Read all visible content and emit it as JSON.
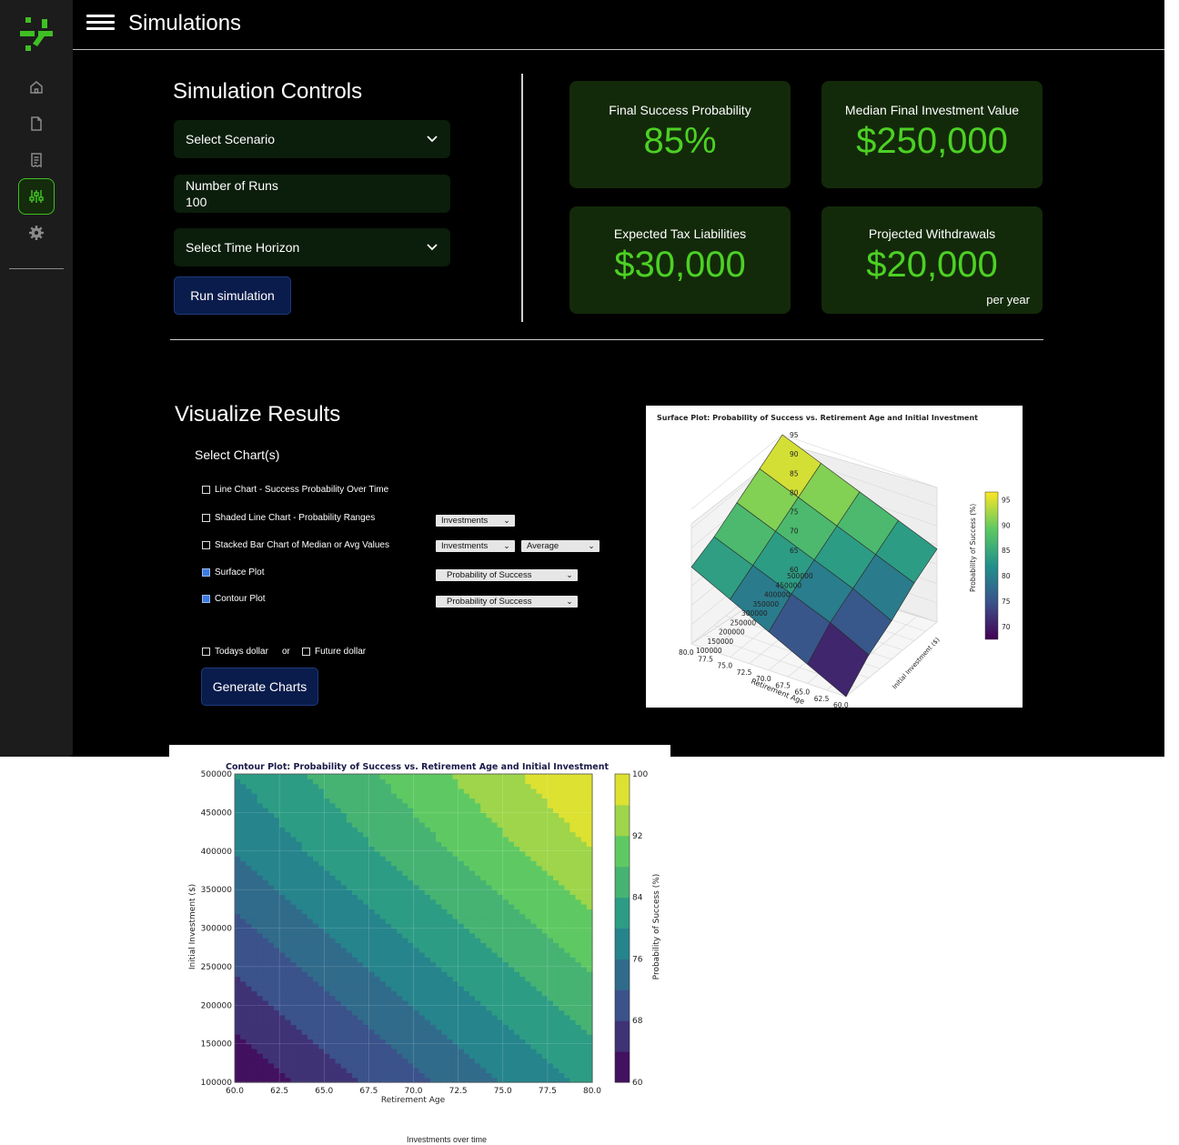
{
  "header": {
    "title": "Simulations"
  },
  "sidebar": {
    "items": [
      {
        "name": "home",
        "icon": "home-icon"
      },
      {
        "name": "documents",
        "icon": "document-icon"
      },
      {
        "name": "reports",
        "icon": "receipt-icon"
      },
      {
        "name": "simulations",
        "icon": "sliders-icon",
        "active": true
      },
      {
        "name": "settings",
        "icon": "gear-icon"
      }
    ],
    "accent": "#3fbf23"
  },
  "controls": {
    "title": "Simulation Controls",
    "scenario_label": "Select Scenario",
    "runs_label": "Number of Runs",
    "runs_value": "100",
    "horizon_label": "Select Time Horizon",
    "run_button": "Run simulation"
  },
  "cards": [
    {
      "label": "Final Success Probability",
      "value": "85%"
    },
    {
      "label": "Median Final Investment Value",
      "value": "$250,000"
    },
    {
      "label": "Expected Tax Liabilities",
      "value": "$30,000"
    },
    {
      "label": "Projected Withdrawals",
      "value": "$20,000",
      "sub": "per year"
    }
  ],
  "visualize": {
    "title": "Visualize Results",
    "select_label": "Select Chart(s)",
    "charts": [
      {
        "label": "Line Chart - Success Probability Over Time",
        "checked": false
      },
      {
        "label": "Shaded Line Chart - Probability Ranges",
        "checked": false,
        "dropdowns": [
          "Investments"
        ]
      },
      {
        "label": "Stacked Bar Chart of Median or Avg Values",
        "checked": false,
        "dropdowns": [
          "Investments",
          "Average"
        ]
      },
      {
        "label": "Surface Plot",
        "checked": true,
        "dropdowns": [
          "Probability of Success"
        ]
      },
      {
        "label": "Contour Plot",
        "checked": true,
        "dropdowns": [
          "Probability of Success"
        ]
      }
    ],
    "todays_dollar": "Todays dollar",
    "or": "or",
    "future_dollar": "Future dollar",
    "generate_button": "Generate Charts"
  },
  "chart_data": [
    {
      "type": "surface",
      "title": "Surface Plot: Probability of Success vs. Retirement Age and Initial Investment",
      "xlabel": "Retirement Age",
      "ylabel": "Initial Investment ($)",
      "zlabel": "Probability of Success (%)",
      "x_ticks": [
        "60.0",
        "62.5",
        "65.0",
        "67.5",
        "70.0",
        "72.5",
        "75.0",
        "77.5",
        "80.0"
      ],
      "y_ticks": [
        "100000",
        "150000",
        "200000",
        "250000",
        "300000",
        "350000",
        "400000",
        "450000",
        "500000"
      ],
      "z_ticks": [
        "60",
        "65",
        "70",
        "75",
        "80",
        "85",
        "90",
        "95"
      ],
      "colorbar_ticks": [
        "70",
        "75",
        "80",
        "85",
        "90",
        "95"
      ],
      "x": [
        60,
        65,
        70,
        75,
        80
      ],
      "y": [
        100000,
        200000,
        300000,
        400000,
        500000
      ],
      "z": [
        [
          60,
          65,
          70,
          75,
          80
        ],
        [
          66,
          71,
          75,
          79,
          83
        ],
        [
          70,
          75,
          79,
          83,
          87
        ],
        [
          75,
          79,
          83,
          87,
          91
        ],
        [
          79,
          83,
          87,
          91,
          95
        ]
      ],
      "zlim": [
        60,
        95
      ]
    },
    {
      "type": "heatmap",
      "title": "Contour Plot: Probability of Success vs. Retirement Age and Initial Investment",
      "xlabel": "Retirement Age",
      "ylabel": "Initial Investment ($)",
      "colorbar_label": "Probability of Success (%)",
      "x_ticks": [
        "60.0",
        "62.5",
        "65.0",
        "67.5",
        "70.0",
        "72.5",
        "75.0",
        "77.5",
        "80.0"
      ],
      "y_ticks": [
        "100000",
        "150000",
        "200000",
        "250000",
        "300000",
        "350000",
        "400000",
        "450000",
        "500000"
      ],
      "colorbar_ticks": [
        "60",
        "68",
        "76",
        "84",
        "92",
        "100"
      ],
      "x": [
        60,
        65,
        70,
        75,
        80
      ],
      "y": [
        100000,
        200000,
        300000,
        400000,
        500000
      ],
      "z": [
        [
          60,
          66,
          71,
          76,
          81
        ],
        [
          66,
          71,
          76,
          81,
          86
        ],
        [
          71,
          76,
          81,
          86,
          91
        ],
        [
          76,
          81,
          86,
          91,
          96
        ],
        [
          80,
          85,
          90,
          95,
          100
        ]
      ],
      "xlim": [
        60,
        80
      ],
      "ylim": [
        100000,
        500000
      ],
      "zlim": [
        60,
        100
      ]
    }
  ],
  "caption": "Investments over time"
}
